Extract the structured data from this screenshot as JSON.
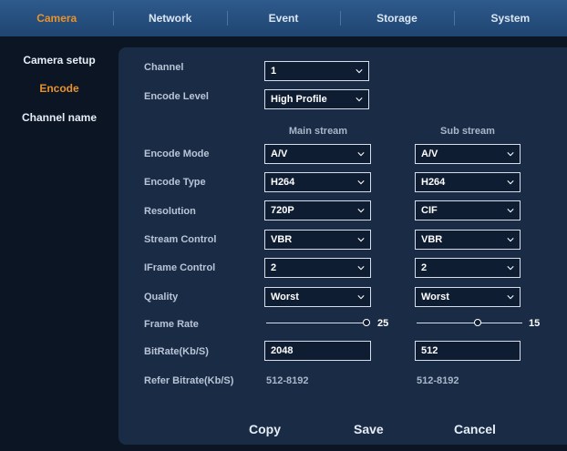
{
  "tabs": [
    {
      "label": "Camera",
      "active": true
    },
    {
      "label": "Network",
      "active": false
    },
    {
      "label": "Event",
      "active": false
    },
    {
      "label": "Storage",
      "active": false
    },
    {
      "label": "System",
      "active": false
    }
  ],
  "sidebar": {
    "items": [
      {
        "label": "Camera setup",
        "active": false
      },
      {
        "label": "Encode",
        "active": true
      },
      {
        "label": "Channel name",
        "active": false
      }
    ]
  },
  "form": {
    "channel": {
      "label": "Channel",
      "value": "1"
    },
    "encode_level": {
      "label": "Encode Level",
      "value": "High Profile"
    },
    "main_stream_header": "Main stream",
    "sub_stream_header": "Sub stream",
    "rows": {
      "encode_mode": {
        "label": "Encode Mode",
        "main": "A/V",
        "sub": "A/V"
      },
      "encode_type": {
        "label": "Encode Type",
        "main": "H264",
        "sub": "H264"
      },
      "resolution": {
        "label": "Resolution",
        "main": "720P",
        "sub": "CIF"
      },
      "stream_control": {
        "label": "Stream Control",
        "main": "VBR",
        "sub": "VBR"
      },
      "iframe_control": {
        "label": "IFrame Control",
        "main": "2",
        "sub": "2"
      },
      "quality": {
        "label": "Quality",
        "main": "Worst",
        "sub": "Worst"
      }
    },
    "frame_rate": {
      "label": "Frame Rate",
      "main": "25",
      "sub": "15",
      "main_level": 1.0,
      "sub_level": 0.58
    },
    "bitrate": {
      "label": "BitRate(Kb/S)",
      "main": "2048",
      "sub": "512"
    },
    "refer_bitrate": {
      "label": "Refer Bitrate(Kb/S)",
      "main": "512-8192",
      "sub": "512-8192"
    }
  },
  "buttons": {
    "copy": "Copy",
    "save": "Save",
    "cancel": "Cancel"
  }
}
